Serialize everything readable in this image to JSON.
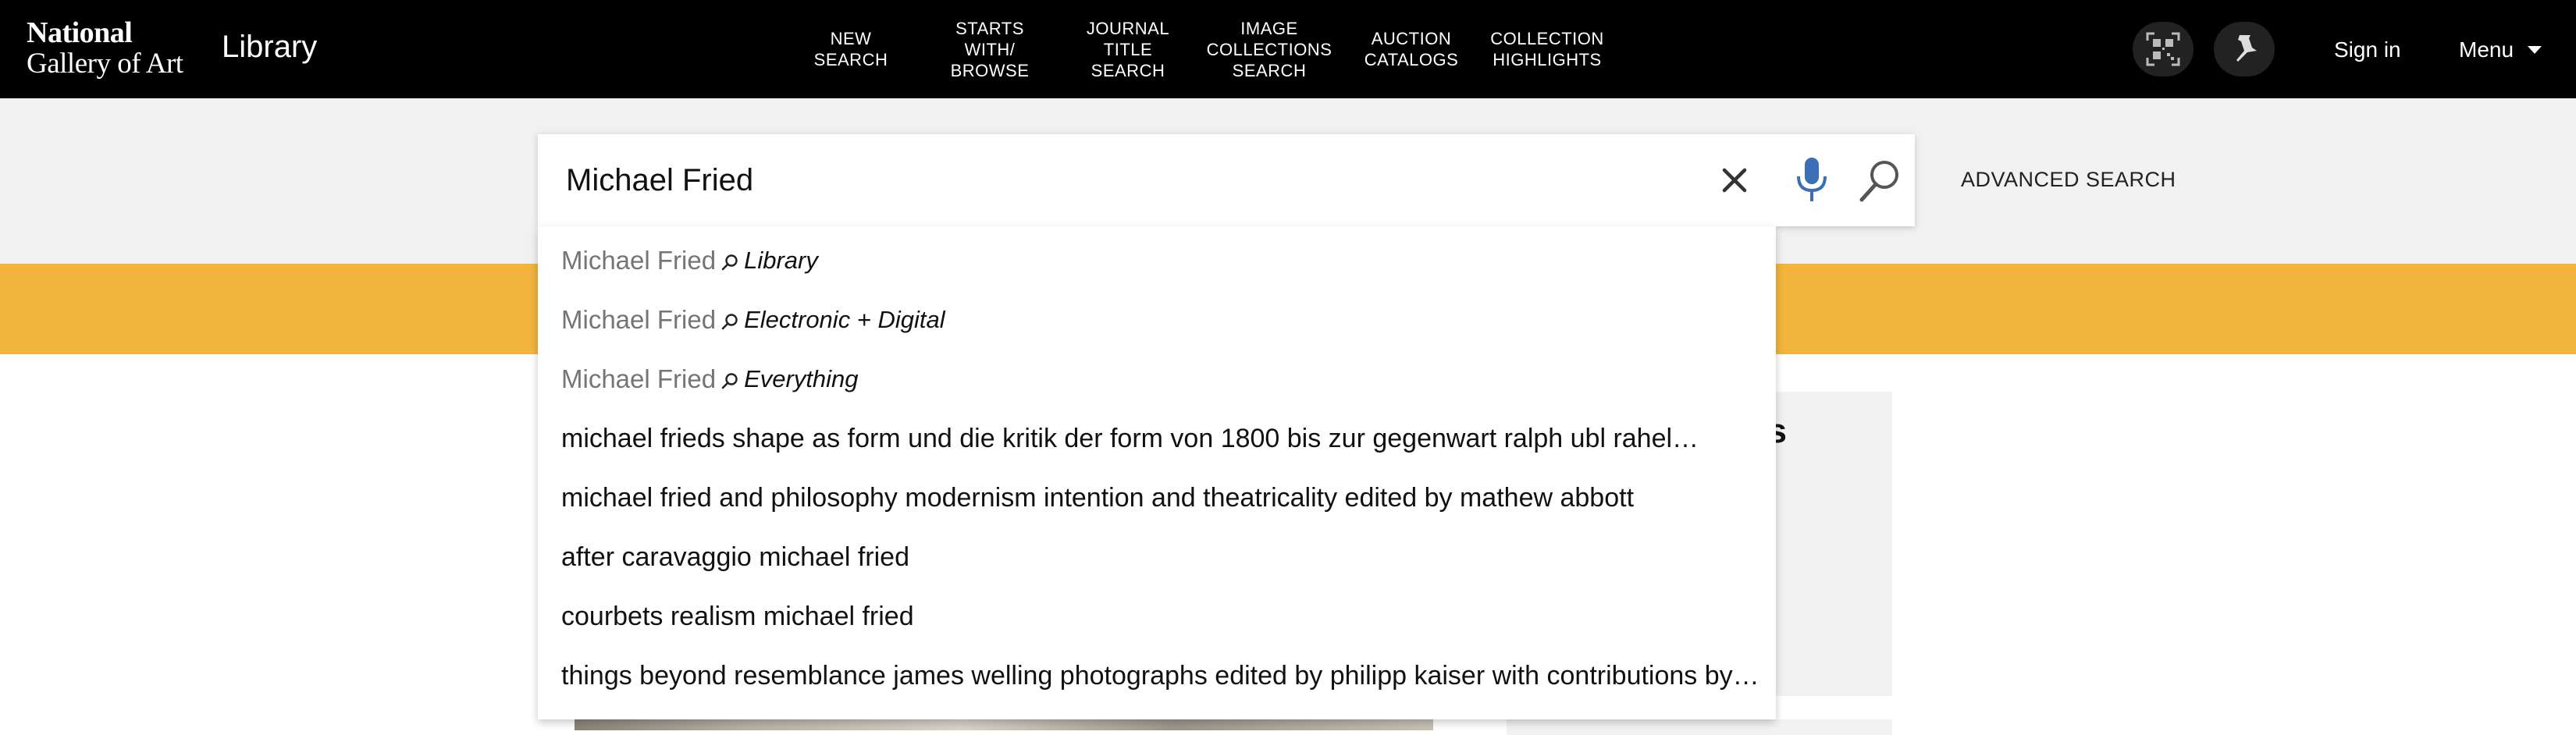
{
  "header": {
    "logo_line1": "National",
    "logo_line2": "Gallery of Art",
    "section_title": "Library",
    "nav": [
      {
        "label": "NEW\nSEARCH"
      },
      {
        "label": "STARTS\nWITH/\nBROWSE"
      },
      {
        "label": "JOURNAL\nTITLE\nSEARCH"
      },
      {
        "label": "IMAGE\nCOLLECTIONS\nSEARCH"
      },
      {
        "label": "AUCTION\nCATALOGS"
      },
      {
        "label": "COLLECTION\nHIGHLIGHTS"
      }
    ],
    "icons": {
      "qr": "qr-code-icon",
      "pin": "pin-icon"
    },
    "sign_in": "Sign in",
    "menu": "Menu"
  },
  "search": {
    "value": "Michael Fried",
    "advanced_label": "ADVANCED SEARCH",
    "icons": {
      "clear": "close-icon",
      "voice": "microphone-icon",
      "submit": "search-icon"
    }
  },
  "suggestions": {
    "scoped": [
      {
        "term": "Michael Fried",
        "scope": "Library"
      },
      {
        "term": "Michael Fried",
        "scope": "Electronic + Digital"
      },
      {
        "term": "Michael Fried",
        "scope": "Everything"
      }
    ],
    "queries": [
      "michael frieds shape as form und die kritik der form von 1800 bis zur gegenwart ralph ubl rahel…",
      "michael fried and philosophy modernism intention and theatricality edited by mathew abbott",
      "after caravaggio michael fried",
      "courbets realism michael fried",
      "things beyond resemblance james welling photographs edited by philipp kaiser with contributions by…"
    ]
  },
  "background": {
    "side_heading_fragment": "es"
  },
  "colors": {
    "header_bg": "#000000",
    "band_bg": "#f1f1f1",
    "accent_yellow": "#f2b43c",
    "mic_blue": "#3c6fb5"
  }
}
